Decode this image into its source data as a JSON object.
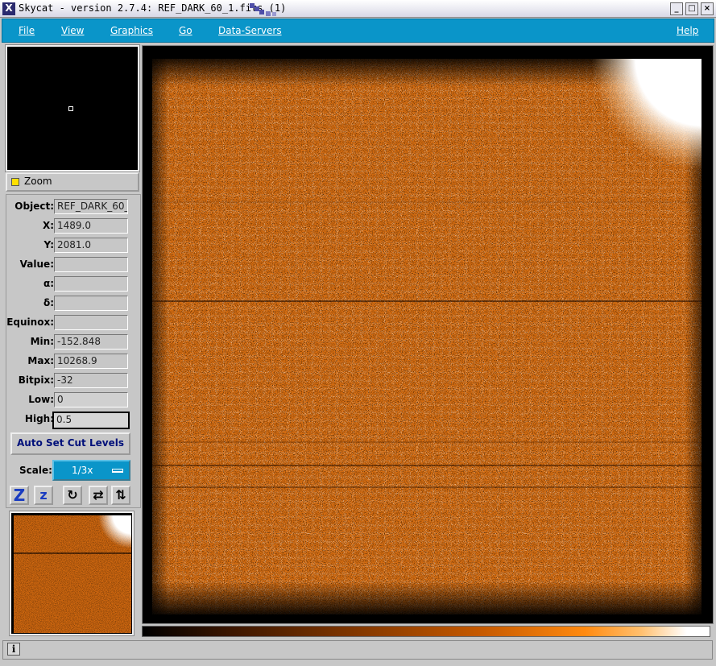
{
  "window": {
    "title": "Skycat - version 2.7.4: REF_DARK_60_1.fits (1)",
    "controls": [
      "minimize-icon",
      "maximize-icon",
      "close-icon"
    ]
  },
  "menu": {
    "file": "File",
    "view": "View",
    "graphics": "Graphics",
    "go": "Go",
    "data_servers": "Data-Servers",
    "help": "Help"
  },
  "zoom": {
    "label": "Zoom"
  },
  "fields": {
    "object": {
      "label": "Object:",
      "value": "REF_DARK_60_"
    },
    "x": {
      "label": "X:",
      "value": "1489.0"
    },
    "y": {
      "label": "Y:",
      "value": "2081.0"
    },
    "value": {
      "label": "Value:",
      "value": ""
    },
    "alpha": {
      "label": "α:",
      "value": ""
    },
    "delta": {
      "label": "δ:",
      "value": ""
    },
    "equinox": {
      "label": "Equinox:",
      "value": ""
    },
    "min": {
      "label": "Min:",
      "value": "-152.848"
    },
    "max": {
      "label": "Max:",
      "value": "10268.9"
    },
    "bitpix": {
      "label": "Bitpix:",
      "value": "-32"
    },
    "low": {
      "label": "Low:",
      "value": "0"
    },
    "high": {
      "label": "High:",
      "value": "0.5"
    }
  },
  "auto_set": {
    "label": "Auto Set Cut Levels"
  },
  "scale": {
    "label": "Scale:",
    "value": "1/3x"
  },
  "tools": {
    "zoom_in": "Z",
    "zoom_out": "z",
    "rotate": "↻",
    "flip_x": "⇄",
    "flip_y": "⇅"
  },
  "status": {
    "icon": "info-icon"
  },
  "colors": {
    "menubar": "#0a95c9",
    "image_orange": "#d96f12",
    "background": "#c7c7c7"
  }
}
